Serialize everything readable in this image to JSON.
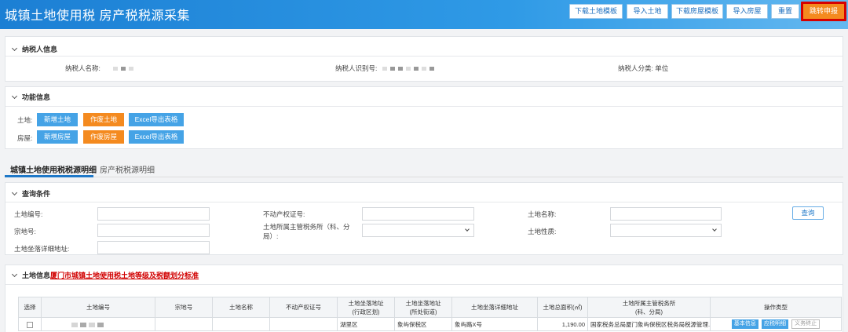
{
  "header": {
    "title": "城镇土地使用税 房产税税源采集",
    "buttons": [
      "下载土地模板",
      "导入土地",
      "下载房屋模板",
      "导入房屋",
      "重置",
      "跳转申报"
    ]
  },
  "taxpayer": {
    "section_title": "纳税人信息",
    "name_label": "纳税人名称:",
    "id_label": "纳税人识别号:",
    "category_label": "纳税人分类:",
    "category_value": "单位"
  },
  "functions": {
    "section_title": "功能信息",
    "land_label": "土地:",
    "house_label": "房屋:",
    "land_buttons": [
      "新增土地",
      "作废土地",
      "Excel导出表格"
    ],
    "house_buttons": [
      "新增房屋",
      "作废房屋",
      "Excel导出表格"
    ]
  },
  "tabs": [
    "城镇土地使用税税源明细",
    "房产税税源明细"
  ],
  "query": {
    "section_title": "查询条件",
    "land_no": "土地编号:",
    "property_cert": "不动产权证号:",
    "land_name": "土地名称:",
    "parcel_no": "宗地号:",
    "tax_office_line1": "土地所属主管税务所（科、分",
    "tax_office_line2": "局）:",
    "land_nature": "土地性质:",
    "address_detail": "土地坐落详细地址:",
    "search_button": "查询"
  },
  "land_info": {
    "section_title": "土地信息",
    "link_text": "厦门市城镇土地使用税土地等级及税额划分标准",
    "columns": [
      [
        "选择"
      ],
      [
        "土地编号"
      ],
      [
        "宗地号"
      ],
      [
        "土地名称"
      ],
      [
        "不动产权证号"
      ],
      [
        "土地坐落地址",
        "(行政区划)"
      ],
      [
        "土地坐落地址",
        "(所处街道)"
      ],
      [
        "土地坐落详细地址"
      ],
      [
        "土地总面积(㎡)"
      ],
      [
        "土地所属主管税务所",
        "(科、分局)"
      ],
      [
        "操作类型"
      ]
    ],
    "row": {
      "district": "湖里区",
      "street": "象屿保税区",
      "address": "象屿路X号",
      "area": "1,190.00",
      "tax_office": "国家税务总局厦门象屿保税区税务局税源管理...",
      "actions": [
        "基本信息",
        "应税明细",
        "义务终止"
      ]
    }
  }
}
